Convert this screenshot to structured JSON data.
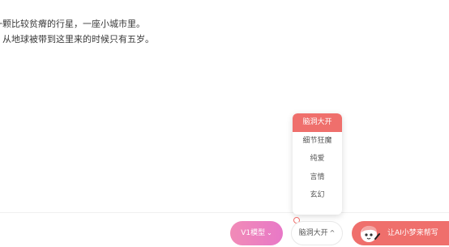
{
  "editor": {
    "lines": [
      "一颗比较贫瘠的行星，一座小城市里。",
      "，从地球被带到这里来的时候只有五岁。"
    ]
  },
  "style_dropdown": {
    "options": [
      "脑洞大开",
      "细节狂魔",
      "纯爱",
      "言情",
      "玄幻"
    ],
    "selected": "脑洞大开"
  },
  "toolbar": {
    "model_label": "V1模型",
    "model_chevron": "⌄",
    "style_label": "脑洞大开",
    "style_chevron": "^",
    "help_label": "让AI小梦来帮写"
  },
  "colors": {
    "accent": "#ef6f6c",
    "model_gradient_start": "#f18bb7",
    "model_gradient_end": "#e878c7"
  }
}
